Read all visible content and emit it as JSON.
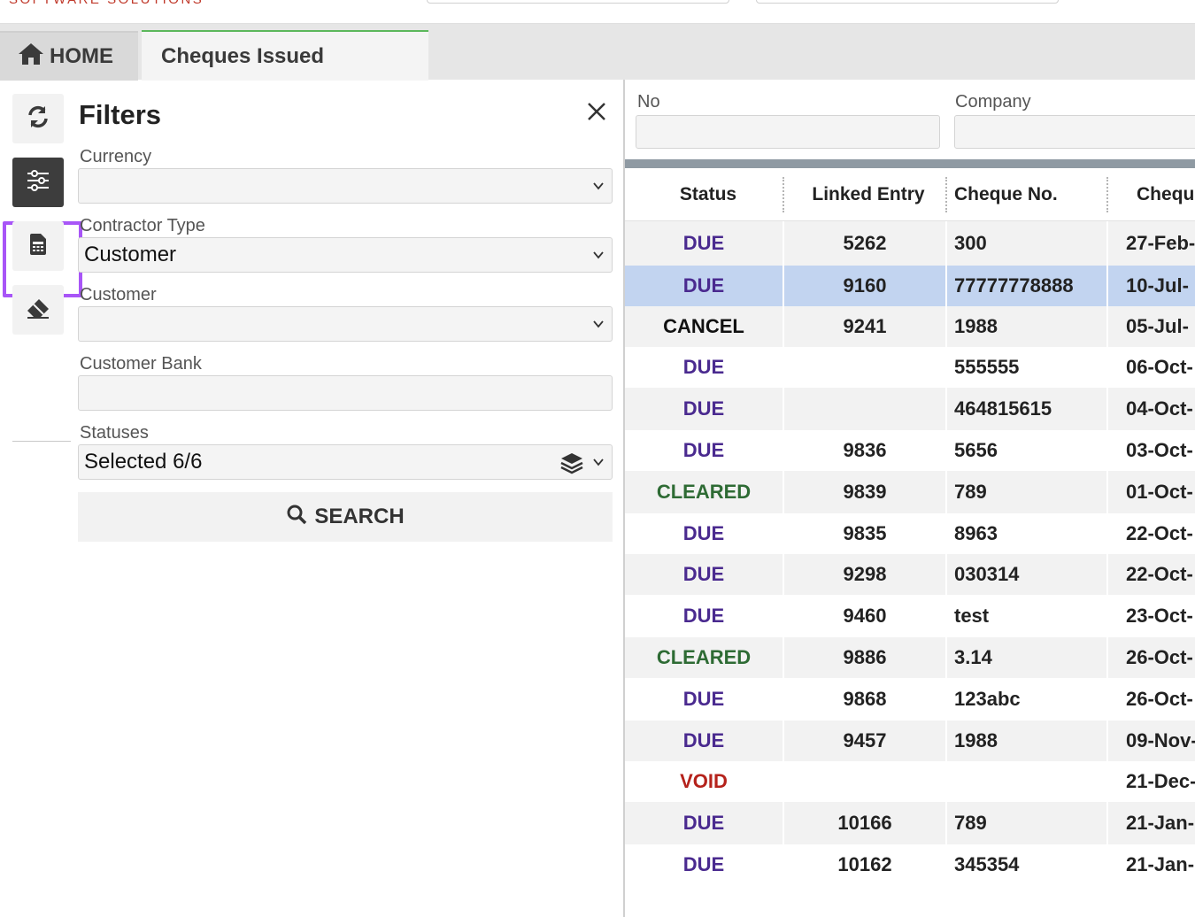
{
  "brand": "SOFTWARE SOLUTIONS",
  "tabs": {
    "home_label": "HOME",
    "active_label": "Cheques Issued"
  },
  "filters": {
    "title": "Filters",
    "currency_label": "Currency",
    "currency_value": "",
    "contractor_type_label": "Contractor Type",
    "contractor_type_value": "Customer",
    "customer_label": "Customer",
    "customer_value": "",
    "customer_bank_label": "Customer Bank",
    "customer_bank_value": "",
    "statuses_label": "Statuses",
    "statuses_value": "Selected 6/6",
    "search_label": "SEARCH"
  },
  "grid": {
    "header_filters": {
      "no_label": "No",
      "company_label": "Company"
    },
    "columns": [
      "Status",
      "Linked Entry",
      "Cheque No.",
      "Cheque"
    ],
    "status_colors": {
      "DUE": "#4a2a8f",
      "CANCEL": "#111111",
      "CLEARED": "#2e6b34",
      "VOID": "#b5221b"
    },
    "rows": [
      {
        "status": "DUE",
        "linked": "5262",
        "cheque": "300",
        "date": "27-Feb-"
      },
      {
        "status": "DUE",
        "linked": "9160",
        "cheque": "77777778888",
        "date": "10-Jul-"
      },
      {
        "status": "CANCEL",
        "linked": "9241",
        "cheque": "1988",
        "date": "05-Jul-"
      },
      {
        "status": "DUE",
        "linked": "",
        "cheque": "555555",
        "date": "06-Oct-"
      },
      {
        "status": "DUE",
        "linked": "",
        "cheque": "464815615",
        "date": "04-Oct-"
      },
      {
        "status": "DUE",
        "linked": "9836",
        "cheque": "5656",
        "date": "03-Oct-"
      },
      {
        "status": "CLEARED",
        "linked": "9839",
        "cheque": "789",
        "date": "01-Oct-"
      },
      {
        "status": "DUE",
        "linked": "9835",
        "cheque": "8963",
        "date": "22-Oct-"
      },
      {
        "status": "DUE",
        "linked": "9298",
        "cheque": "030314",
        "date": "22-Oct-"
      },
      {
        "status": "DUE",
        "linked": "9460",
        "cheque": "test",
        "date": "23-Oct-"
      },
      {
        "status": "CLEARED",
        "linked": "9886",
        "cheque": "3.14",
        "date": "26-Oct-"
      },
      {
        "status": "DUE",
        "linked": "9868",
        "cheque": "123abc",
        "date": "26-Oct-"
      },
      {
        "status": "DUE",
        "linked": "9457",
        "cheque": "1988",
        "date": "09-Nov-"
      },
      {
        "status": "VOID",
        "linked": "",
        "cheque": "",
        "date": "21-Dec-"
      },
      {
        "status": "DUE",
        "linked": "10166",
        "cheque": "789",
        "date": "21-Jan-"
      },
      {
        "status": "DUE",
        "linked": "10162",
        "cheque": "345354",
        "date": "21-Jan-"
      }
    ],
    "selected_row": 1
  },
  "icons": {
    "home": "home-icon",
    "refresh": "refresh-icon",
    "filters": "sliders-icon",
    "calc": "calculator-icon",
    "eraser": "eraser-icon",
    "close": "close-icon",
    "chevron": "chevron-down-icon",
    "layers": "layers-icon",
    "search": "search-icon"
  },
  "colors": {
    "tab_accent": "#5cb85c",
    "highlight": "#a855f7",
    "selected_row": "#c2d4f0"
  }
}
